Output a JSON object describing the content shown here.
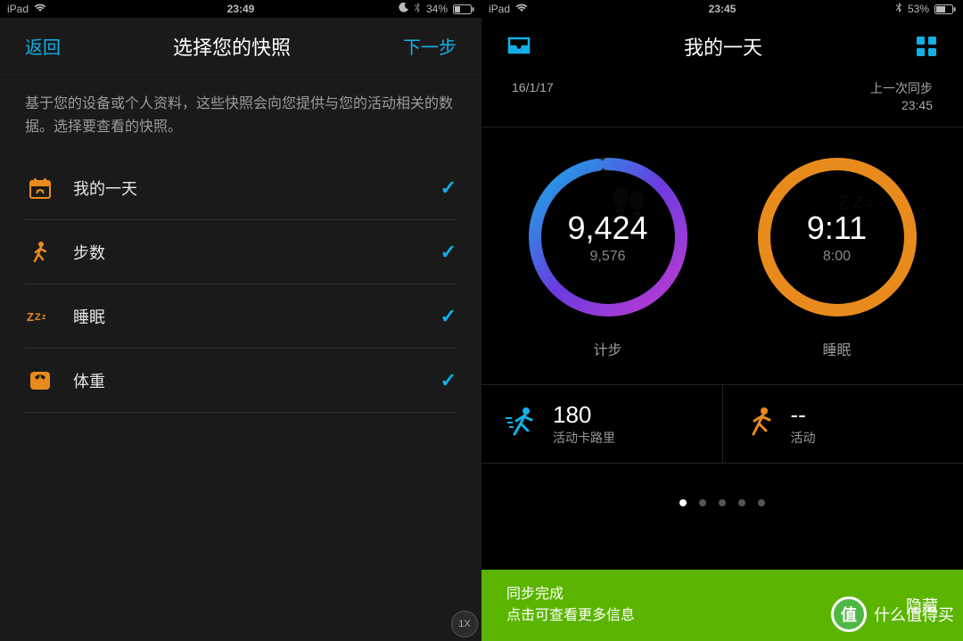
{
  "left_status": {
    "device": "iPad",
    "time": "23:49",
    "battery_text": "34%",
    "battery_pct": 34
  },
  "right_status": {
    "device": "iPad",
    "time": "23:45",
    "battery_text": "53%",
    "battery_pct": 53
  },
  "screen1": {
    "back": "返回",
    "title": "选择您的快照",
    "next": "下一步",
    "description": "基于您的设备或个人资料，这些快照会向您提供与您的活动相关的数据。选择要查看的快照。",
    "items": [
      {
        "icon": "calendar",
        "label": "我的一天",
        "checked": true
      },
      {
        "icon": "walk",
        "label": "步数",
        "checked": true
      },
      {
        "icon": "sleep",
        "label": "睡眠",
        "checked": true
      },
      {
        "icon": "scale",
        "label": "体重",
        "checked": true
      }
    ],
    "badge": "1X"
  },
  "screen2": {
    "title": "我的一天",
    "date": "16/1/17",
    "last_sync_label": "上一次同步",
    "last_sync_time": "23:45",
    "steps": {
      "value": "9,424",
      "goal": "9,576",
      "label": "计步"
    },
    "sleep": {
      "value": "9:11",
      "goal": "8:00",
      "label": "睡眠"
    },
    "calories": {
      "value": "180",
      "label": "活动卡路里"
    },
    "activity": {
      "value": "--",
      "label": "活动"
    },
    "page_dots": {
      "count": 5,
      "active": 0
    },
    "sync": {
      "title": "同步完成",
      "sub": "点击可查看更多信息",
      "hide": "隐藏"
    }
  },
  "watermark": "什么值得买"
}
